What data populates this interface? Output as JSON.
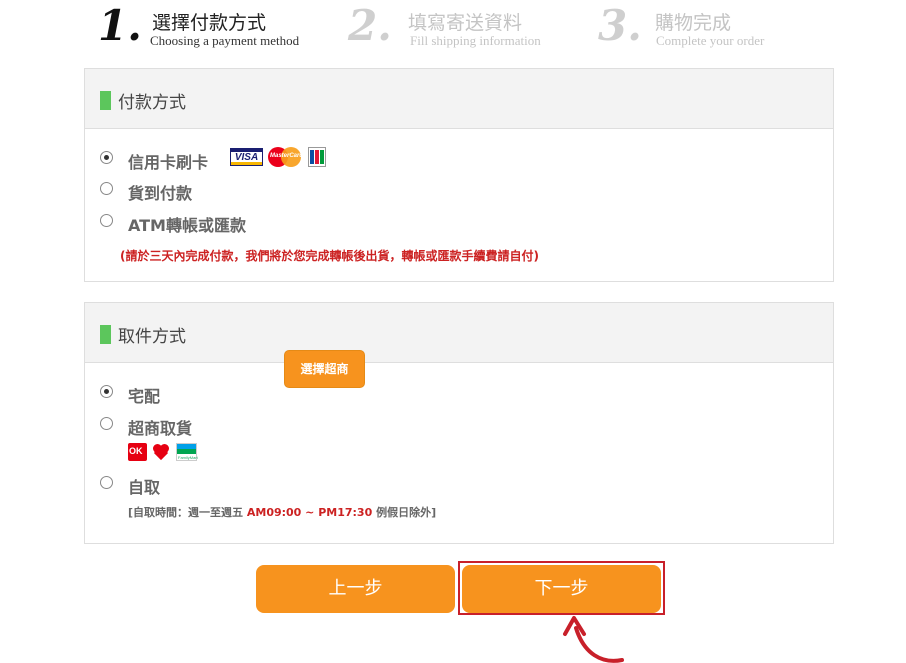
{
  "steps": [
    {
      "number": "1.",
      "title": "選擇付款方式",
      "subtitle": "Choosing a payment method",
      "active": true
    },
    {
      "number": "2.",
      "title": "填寫寄送資料",
      "subtitle": "Fill shipping information",
      "active": false
    },
    {
      "number": "3.",
      "title": "購物完成",
      "subtitle": "Complete your order",
      "active": false
    }
  ],
  "payment": {
    "title": "付款方式",
    "options": [
      {
        "label": "信用卡刷卡",
        "checked": true
      },
      {
        "label": "貨到付款",
        "checked": false
      },
      {
        "label": "ATM轉帳或匯款",
        "checked": false
      }
    ],
    "card_logos": [
      "VISA",
      "MasterCard",
      "JCB"
    ],
    "note": "(請於三天內完成付款，我們將於您完成轉帳後出貨，轉帳或匯款手續費請自付)"
  },
  "pickup": {
    "title": "取件方式",
    "options": [
      {
        "label": "宅配",
        "checked": true
      },
      {
        "label": "超商取貨",
        "checked": false
      },
      {
        "label": "自取",
        "checked": false
      }
    ],
    "store_logos": [
      "OK",
      "Hi-Life",
      "FamilyMart"
    ],
    "select_store_label": "選擇超商",
    "self_pickup_note_prefix": "[自取時間：週一至週五 ",
    "self_pickup_time": "AM09:00 ~ PM17:30",
    "self_pickup_note_suffix": " 例假日除外]"
  },
  "buttons": {
    "prev_label": "上一步",
    "next_label": "下一步"
  },
  "colors": {
    "accent": "#f7931e",
    "section_marker": "#5cc65c",
    "highlight": "#c8202a",
    "warning_text": "#cc2222"
  },
  "icons": [
    "visa-icon",
    "mastercard-icon",
    "jcb-icon",
    "ok-mart-icon",
    "hilife-icon",
    "familymart-icon",
    "curved-arrow-icon"
  ]
}
